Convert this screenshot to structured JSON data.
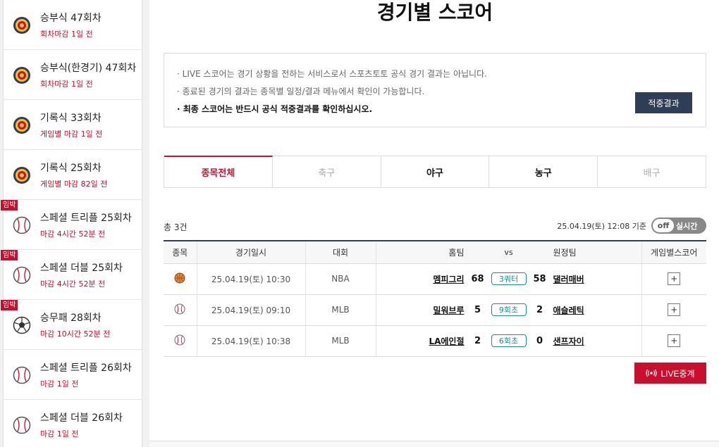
{
  "sidebar": {
    "items": [
      {
        "title": "승부식 47회차",
        "sub": "회차마감 1일 전",
        "icon": "target-icon",
        "badge": ""
      },
      {
        "title": "승부식(한경기) 47회차",
        "sub": "회차마감 1일 전",
        "icon": "target-icon",
        "badge": ""
      },
      {
        "title": "기록식 33회차",
        "sub": "게임별 마감 1일 전",
        "icon": "target-icon",
        "badge": ""
      },
      {
        "title": "기록식 25회차",
        "sub": "게임별 마감 82일 전",
        "icon": "target-icon",
        "badge": ""
      },
      {
        "title": "스페셜 트리플 25회차",
        "sub": "마감 4시간 52분 전",
        "icon": "baseball-icon",
        "badge": "임박"
      },
      {
        "title": "스페셜 더블 25회차",
        "sub": "마감 4시간 52분 전",
        "icon": "baseball-icon",
        "badge": "임박"
      },
      {
        "title": "승무패 28회차",
        "sub": "마감 10시간 52분 전",
        "icon": "soccer-ball-icon",
        "badge": "임박"
      },
      {
        "title": "스페셜 트리플 26회차",
        "sub": "마감 1일 전",
        "icon": "baseball-icon",
        "badge": ""
      },
      {
        "title": "스페셜 더블 26회차",
        "sub": "마감 1일 전",
        "icon": "baseball-icon",
        "badge": ""
      }
    ]
  },
  "main": {
    "title": "경기별 스코어",
    "notice": [
      "· LIVE 스코어는 경기 상황을 전하는 서비스로서 스포츠토토 공식 경기 결과는 아닙니다.",
      "· 종료된 경기의 결과는 종목별 일정/결과 메뉴에서 확인이 가능합니다.",
      "· 최종 스코어는 반드시 공식 적중결과를 확인하십시오."
    ],
    "result_button": "적중결과",
    "tabs": [
      "종목전체",
      "축구",
      "야구",
      "농구",
      "배구"
    ],
    "count": "총 3건",
    "updated": "25.04.19(토) 12:08 기준",
    "toggle": {
      "off": "off",
      "label": "실시간"
    },
    "live_button": "LIVE중계"
  },
  "table": {
    "headers": {
      "sport": "종목",
      "datetime": "경기일시",
      "league": "대회",
      "home": "홈팀",
      "vs": "vs",
      "away": "원정팀",
      "detail": "게임별스코어"
    },
    "rows": [
      {
        "sport_icon": "basketball-icon",
        "datetime": "25.04.19(토) 10:30",
        "league": "NBA",
        "home": "멤피그리",
        "home_score": "68",
        "status": "3쿼터",
        "away_score": "58",
        "away": "댈러매버",
        "detail": "+"
      },
      {
        "sport_icon": "baseball-icon",
        "datetime": "25.04.19(토) 09:10",
        "league": "MLB",
        "home": "밀워브루",
        "home_score": "5",
        "status": "9회초",
        "away_score": "2",
        "away": "애슬레틱",
        "detail": "+"
      },
      {
        "sport_icon": "baseball-icon",
        "datetime": "25.04.19(토) 10:38",
        "league": "MLB",
        "home": "LA에인절",
        "home_score": "2",
        "status": "6회초",
        "away_score": "0",
        "away": "샌프자이",
        "detail": "+"
      }
    ]
  },
  "colors": {
    "accent": "#c8102e",
    "navy": "#2f3d56",
    "teal": "#1a8f8f"
  }
}
